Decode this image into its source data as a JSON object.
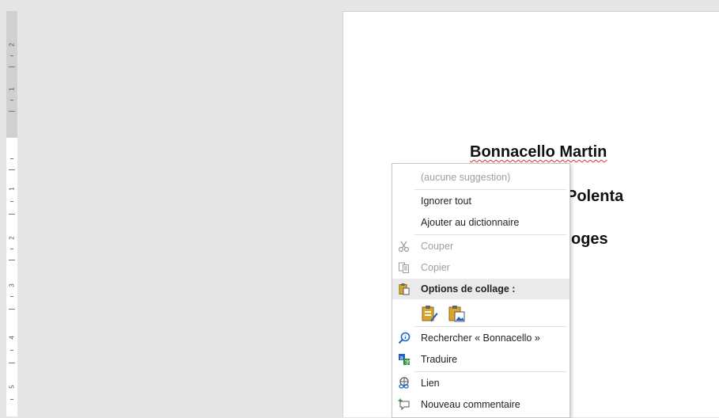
{
  "document": {
    "lines": [
      "Bonnacello Martin",
      "Polenta",
      "oges"
    ]
  },
  "ruler": {
    "numbers": [
      "2",
      "1",
      "1",
      "2",
      "3",
      "4",
      "5"
    ]
  },
  "context_menu": {
    "no_suggestion": "(aucune suggestion)",
    "ignore_all": "Ignorer tout",
    "add_to_dictionary": "Ajouter au dictionnaire",
    "cut": "Couper",
    "copy": "Copier",
    "paste_options": "Options de collage :",
    "search": "Rechercher « Bonnacello »",
    "translate": "Traduire",
    "link": "Lien",
    "new_comment": "Nouveau commentaire"
  },
  "colors": {
    "spell_underline": "#e03030",
    "icon_blue": "#1e64c8",
    "icon_green": "#2e8b3a",
    "icon_gold": "#d9a52a"
  }
}
